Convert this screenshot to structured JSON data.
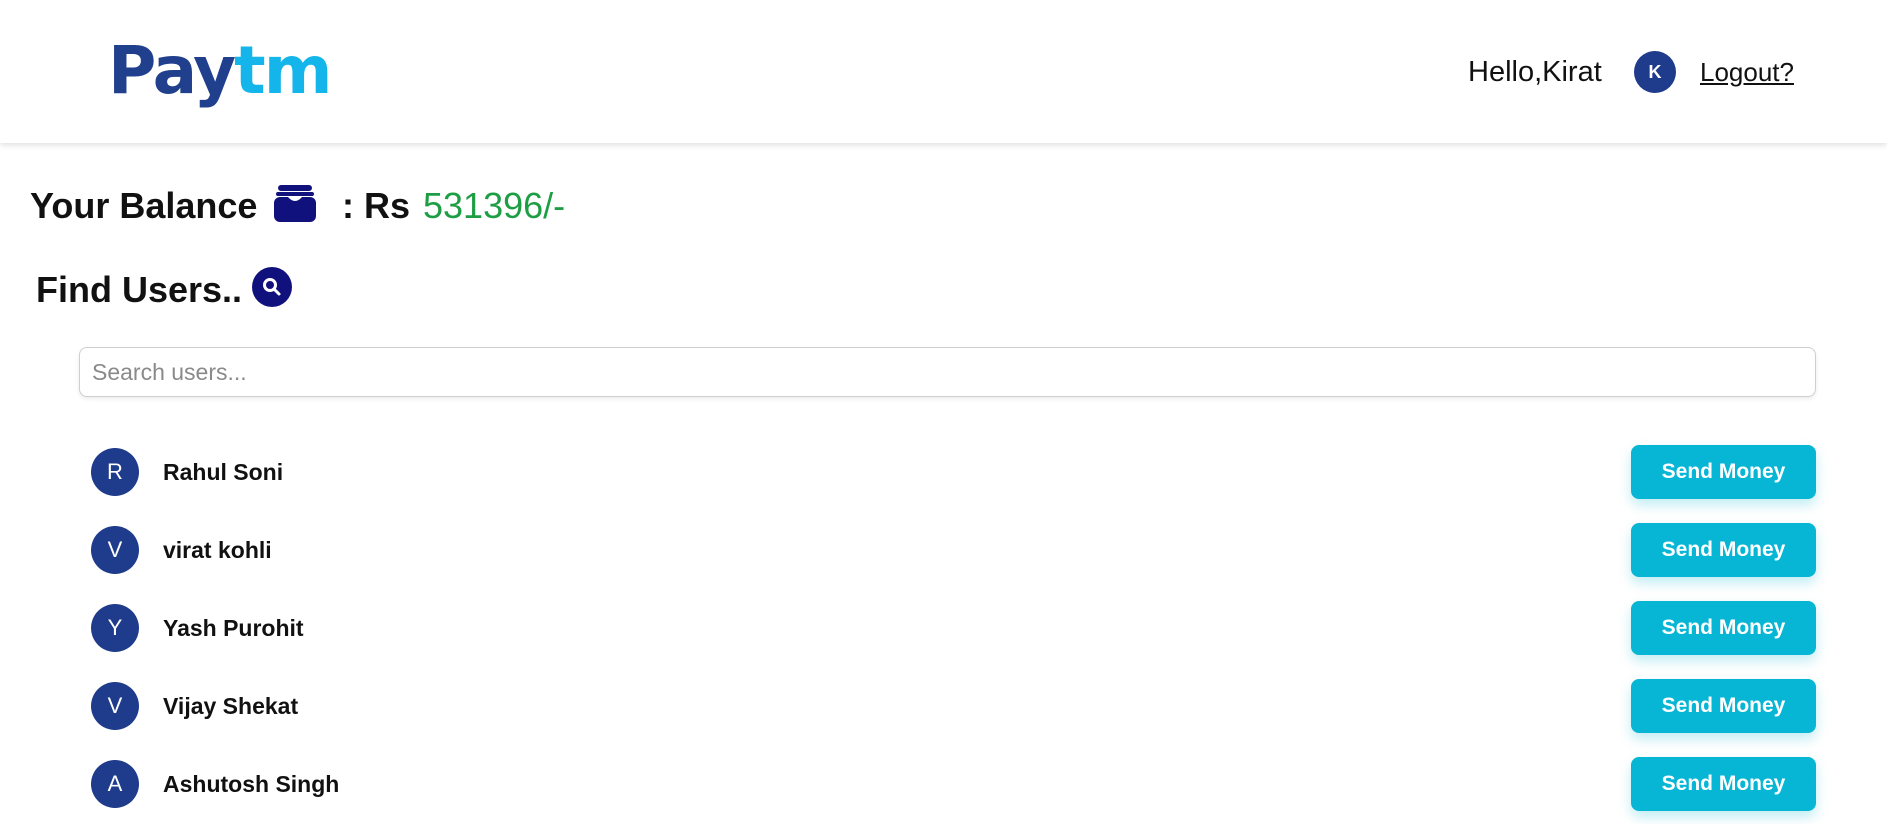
{
  "header": {
    "logo": {
      "part1": "Pay",
      "part2": "tm"
    },
    "greeting": "Hello,Kirat",
    "user_initial": "K",
    "logout_label": "Logout?"
  },
  "balance": {
    "label": "Your Balance",
    "icon": "wallet-icon",
    "currency_label": ": Rs",
    "amount": "531396/-",
    "amount_color": "#1e9e44"
  },
  "find_users": {
    "title": "Find Users..",
    "icon": "search-icon",
    "search_placeholder": "Search users...",
    "search_value": ""
  },
  "users": [
    {
      "initial": "R",
      "name": "Rahul Soni",
      "action_label": "Send Money"
    },
    {
      "initial": "V",
      "name": "virat kohli",
      "action_label": "Send Money"
    },
    {
      "initial": "Y",
      "name": "Yash Purohit",
      "action_label": "Send Money"
    },
    {
      "initial": "V",
      "name": "Vijay Shekat",
      "action_label": "Send Money"
    },
    {
      "initial": "A",
      "name": "Ashutosh Singh",
      "action_label": "Send Money"
    }
  ],
  "colors": {
    "brand_dark": "#203f8c",
    "brand_light": "#14b5ea",
    "button": "#06b6d4",
    "avatar": "#1f3b8b"
  }
}
